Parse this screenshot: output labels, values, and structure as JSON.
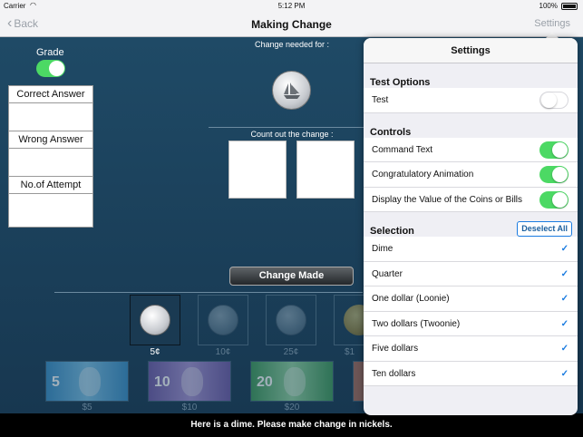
{
  "status_bar": {
    "carrier": "Carrier",
    "time": "5:12 PM",
    "battery": "100%"
  },
  "nav": {
    "back": "Back",
    "title": "Making Change",
    "settings": "Settings"
  },
  "main": {
    "grade_label": "Grade",
    "grade_on": true,
    "stats": {
      "correct": "Correct Answer",
      "wrong": "Wrong Answer",
      "attempts": "No.of Attempt"
    },
    "change_needed_label": "Change needed for :",
    "count_label": "Count out the change :",
    "change_made_button": "Change Made",
    "coins": [
      {
        "name": "dime",
        "value": "5¢"
      },
      {
        "name": "nickel",
        "value": "10¢"
      },
      {
        "name": "quarter",
        "value": "25¢"
      },
      {
        "name": "loonie",
        "value": "$1"
      }
    ],
    "bills": [
      {
        "numeral": "5",
        "value": "$5"
      },
      {
        "numeral": "10",
        "value": "$10"
      },
      {
        "numeral": "20",
        "value": "$20"
      }
    ]
  },
  "instruction": "Here is a dime. Please make change in nickels.",
  "settings": {
    "title": "Settings",
    "test_options": {
      "header": "Test Options",
      "test_label": "Test",
      "test_on": false
    },
    "controls": {
      "header": "Controls",
      "items": [
        {
          "label": "Command Text",
          "on": true
        },
        {
          "label": "Congratulatory Animation",
          "on": true
        },
        {
          "label": "Display the Value of the Coins or Bills",
          "on": true
        }
      ]
    },
    "selection": {
      "header": "Selection",
      "deselect_all": "Deselect All",
      "items": [
        {
          "label": "Dime",
          "checked": true
        },
        {
          "label": "Quarter",
          "checked": true
        },
        {
          "label": "One dollar (Loonie)",
          "checked": true
        },
        {
          "label": "Two dollars (Twoonie)",
          "checked": true
        },
        {
          "label": "Five dollars",
          "checked": true
        },
        {
          "label": "Ten dollars",
          "checked": true
        }
      ]
    },
    "check_glyph": "✓"
  }
}
